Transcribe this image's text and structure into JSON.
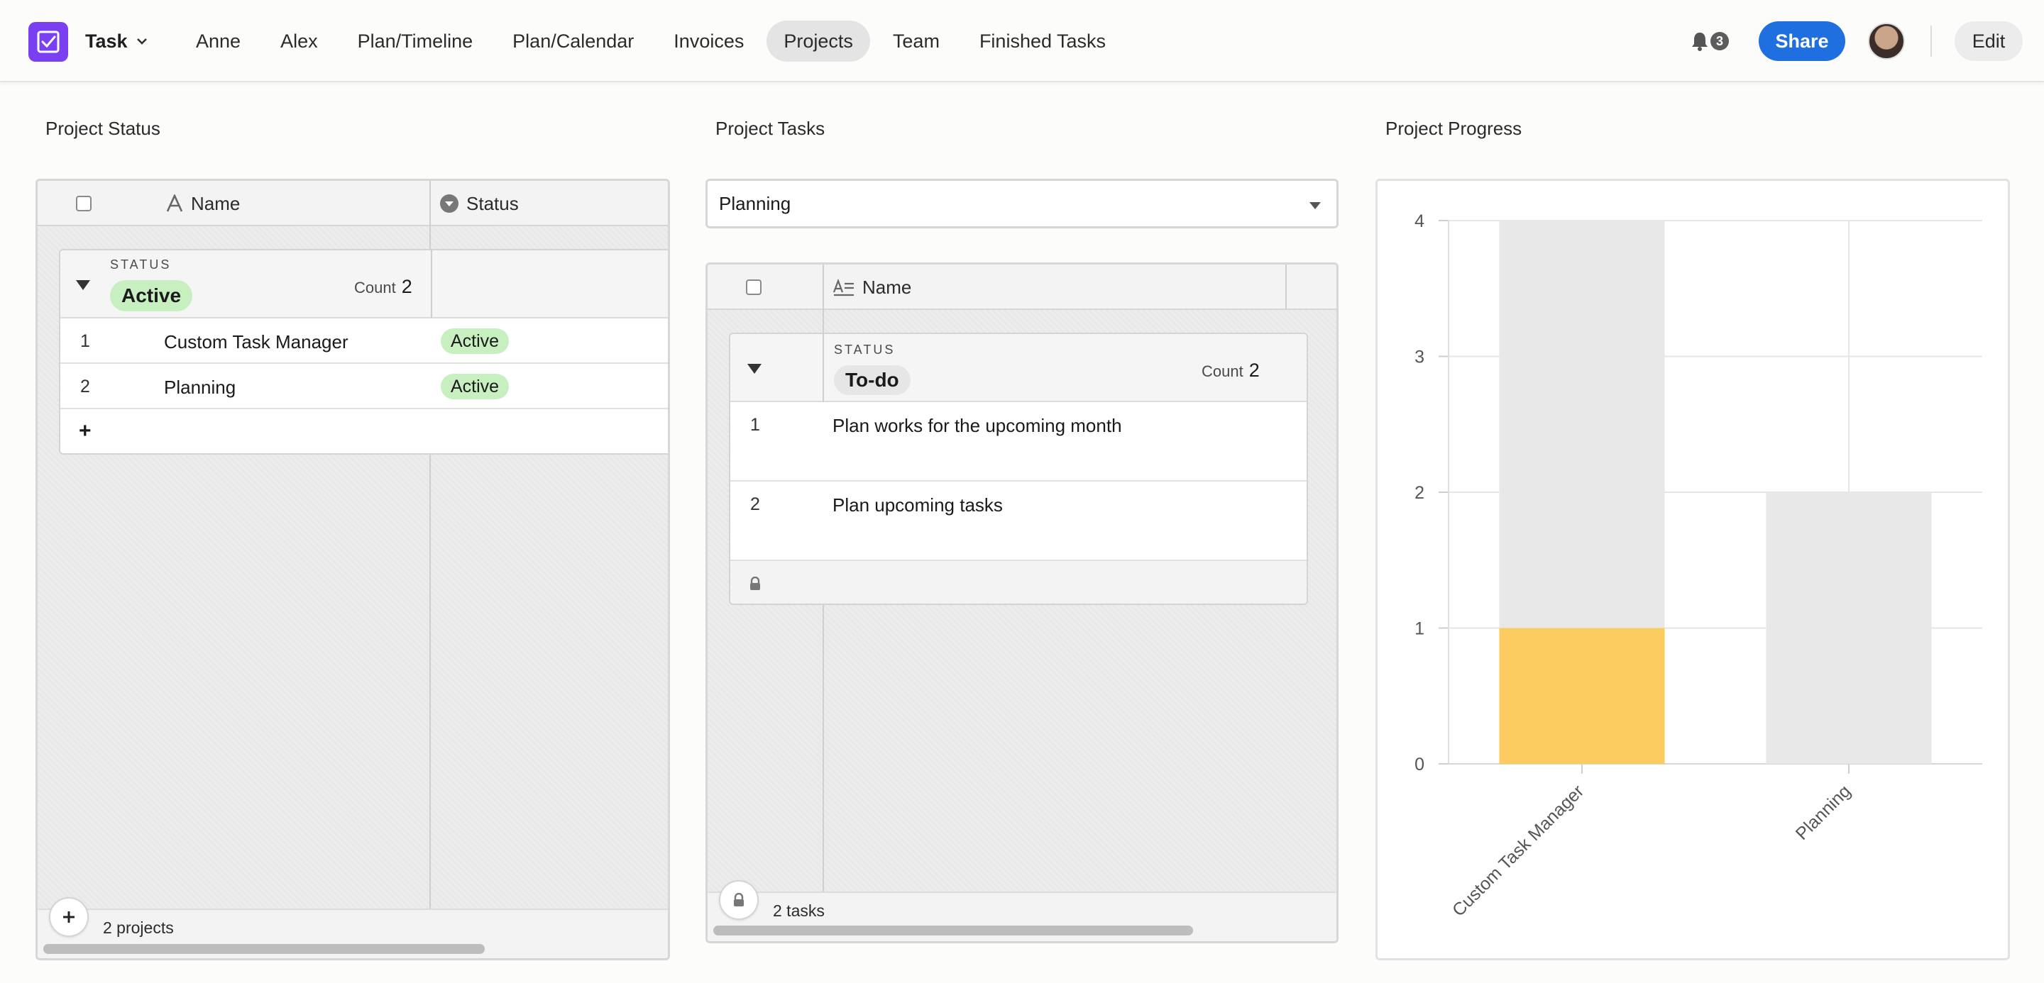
{
  "app": {
    "name": "Task"
  },
  "nav": {
    "tabs": [
      {
        "label": "Anne",
        "active": false
      },
      {
        "label": "Alex",
        "active": false
      },
      {
        "label": "Plan/Timeline",
        "active": false
      },
      {
        "label": "Plan/Calendar",
        "active": false
      },
      {
        "label": "Invoices",
        "active": false
      },
      {
        "label": "Projects",
        "active": true
      },
      {
        "label": "Team",
        "active": false
      },
      {
        "label": "Finished Tasks",
        "active": false
      }
    ],
    "notifications_count": "3",
    "share_label": "Share",
    "edit_label": "Edit"
  },
  "project_status": {
    "title": "Project Status",
    "columns": {
      "name": "Name",
      "status": "Status"
    },
    "group": {
      "kicker": "STATUS",
      "value": "Active",
      "count_label": "Count",
      "count": "2"
    },
    "rows": [
      {
        "num": "1",
        "name": "Custom Task Manager",
        "status": "Active"
      },
      {
        "num": "2",
        "name": "Planning",
        "status": "Active"
      }
    ],
    "add_row_label": "+",
    "footer": "2 projects"
  },
  "project_tasks": {
    "title": "Project Tasks",
    "filter_value": "Planning",
    "columns": {
      "name": "Name"
    },
    "group": {
      "kicker": "STATUS",
      "value": "To-do",
      "count_label": "Count",
      "count": "2"
    },
    "rows": [
      {
        "num": "1",
        "name": "Plan works for the upcoming month"
      },
      {
        "num": "2",
        "name": "Plan upcoming tasks"
      }
    ],
    "footer": "2 tasks"
  },
  "project_progress": {
    "title": "Project Progress"
  },
  "colors": {
    "accent": "#7b3ff2",
    "share": "#1f6fe0",
    "done_bar": "#fccc61",
    "total_bar": "#e8e8e8",
    "active_chip": "#c7efc0"
  },
  "chart_data": {
    "type": "bar",
    "stacked": true,
    "categories": [
      "Custom Task Manager",
      "Planning"
    ],
    "series": [
      {
        "values": [
          1,
          0
        ],
        "color": "#fccc61"
      },
      {
        "values": [
          3,
          2
        ],
        "color": "#e8e8e8"
      }
    ],
    "ylim": [
      0,
      4
    ],
    "yticks": [
      "0",
      "1",
      "2",
      "3",
      "4"
    ],
    "grid": true,
    "x_tick_rotation_deg": -45
  }
}
